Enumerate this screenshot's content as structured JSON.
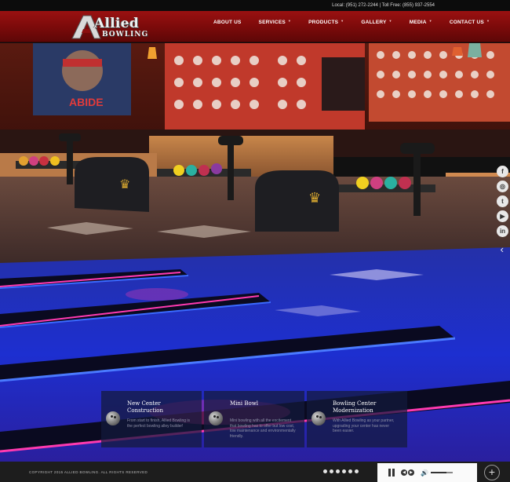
{
  "topbar": {
    "contact": "Local: (951) 272-2244 | Toll Free: (855) 937-2554"
  },
  "logo": {
    "line1": "Allied",
    "line2": "BOWLING"
  },
  "nav": [
    {
      "label": "ABOUT US",
      "dropdown": false
    },
    {
      "label": "SERVICES",
      "dropdown": true
    },
    {
      "label": "PRODUCTS",
      "dropdown": true
    },
    {
      "label": "GALLERY",
      "dropdown": true
    },
    {
      "label": "MEDIA",
      "dropdown": true
    },
    {
      "label": "CONTACT US",
      "dropdown": true
    }
  ],
  "hero": {
    "poster_text": "ABIDE"
  },
  "social": [
    {
      "name": "facebook-icon",
      "glyph": "f"
    },
    {
      "name": "instagram-icon",
      "glyph": "◎"
    },
    {
      "name": "twitter-icon",
      "glyph": "t"
    },
    {
      "name": "youtube-icon",
      "glyph": "▶"
    },
    {
      "name": "linkedin-icon",
      "glyph": "in"
    }
  ],
  "features": [
    {
      "title": "New Center Construction",
      "text": "From start to finish, Allied Bowling is the perfect bowling alley builder!"
    },
    {
      "title": "Mini Bowl",
      "text": "Mini bowling with all the excitement that bowling has to offer but low cost, low maintenance and environmentally friendly."
    },
    {
      "title": "Bowling Center Modernization",
      "text": "With Allied Bowling as your partner, upgrading your center has never been easier."
    }
  ],
  "footer": {
    "copyright": "COPYRIGHT 2015 ALLIED BOWLING. ALL RIGHTS RESERVED",
    "slide_count": 6,
    "volume": 0.7
  },
  "colors": {
    "header": "#8a0e0e",
    "accent_blue": "#2a3cff",
    "accent_pink": "#ff2fa8"
  }
}
